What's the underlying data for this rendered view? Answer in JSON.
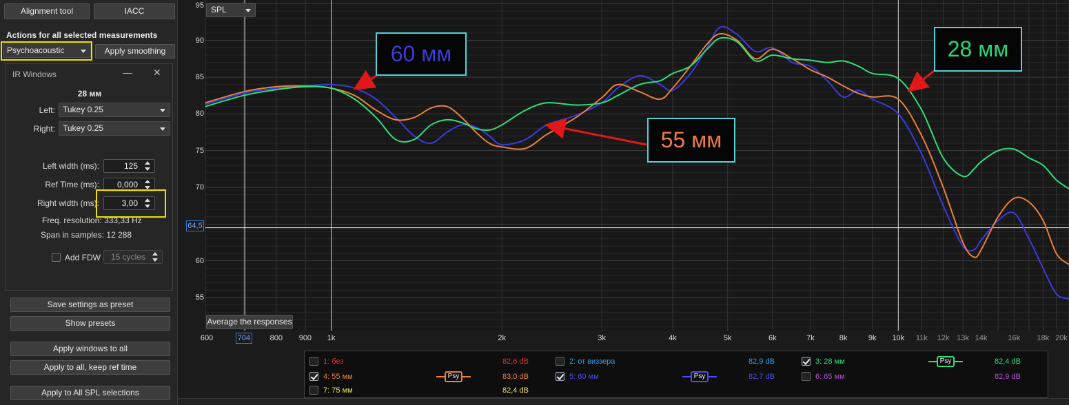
{
  "left_panel": {
    "alignment_tool": "Alignment tool",
    "iacc": "IACC",
    "actions_label": "Actions for all selected measurements",
    "smoothing_select": "Psychoacoustic",
    "apply_smoothing": "Apply smoothing",
    "save_preset": "Save settings as preset",
    "show_presets": "Show presets",
    "apply_windows_all": "Apply windows to all",
    "apply_keep_ref": "Apply to all, keep ref time",
    "apply_all_spl": "Apply to All SPL selections"
  },
  "ir_windows": {
    "title": "IR Windows",
    "minimize": "—",
    "close": "✕",
    "measurement_name": "28 мм",
    "left_label": "Left:",
    "left_value": "Tukey 0.25",
    "right_label": "Right:",
    "right_value": "Tukey 0.25",
    "left_width_label": "Left width (ms):",
    "left_width_value": "125",
    "ref_time_label": "Ref Time (ms):",
    "ref_time_value": "0,000",
    "right_width_label": "Right width (ms):",
    "right_width_value": "3,00",
    "freq_res_label": "Freq. resolution:",
    "freq_res_value": "333,33 Hz",
    "span_label": "Span in samples:",
    "span_value": "12 288",
    "add_fdw_label": "Add FDW",
    "fdw_cycles": "15 cycles"
  },
  "chart_controls": {
    "spl_select": "SPL",
    "average_button": "Average the responses",
    "cursor_y": "64,5",
    "cursor_x": "704"
  },
  "annotations": [
    {
      "text": "60 мм",
      "color": "#3b3bd6"
    },
    {
      "text": "55 мм",
      "color": "#f07848"
    },
    {
      "text": "28 мм",
      "color": "#27d67a"
    }
  ],
  "chart_data": {
    "type": "line",
    "xscale": "log",
    "xlim": [
      600,
      20000
    ],
    "ylim": [
      50.5,
      95.5
    ],
    "x_ticks": [
      "600",
      "800",
      "900",
      "1k",
      "2k",
      "3k",
      "4k",
      "5k",
      "6k",
      "7k",
      "8k",
      "9k",
      "10k",
      "11k",
      "12k",
      "13k",
      "14k",
      "16k",
      "18k",
      "20k"
    ],
    "y_ticks": [
      95,
      90,
      85,
      80,
      75,
      70,
      65,
      60,
      55
    ],
    "y_ticks_shown": [
      "95",
      "90",
      "85",
      "80",
      "75",
      "70",
      "60",
      "55"
    ],
    "series": [
      {
        "name": "5: 60 мм",
        "color": "#3a3ae0",
        "x": [
          600,
          700,
          800,
          900,
          1000,
          1100,
          1200,
          1300,
          1400,
          1500,
          1600,
          1700,
          1800,
          1900,
          2000,
          2200,
          2400,
          2700,
          3000,
          3200,
          3500,
          3800,
          4000,
          4300,
          4600,
          4850,
          5200,
          5600,
          6000,
          6500,
          7000,
          7500,
          8000,
          8500,
          9000,
          10000,
          11000,
          12000,
          13000,
          13600,
          14000,
          15000,
          16000,
          17000,
          18000,
          19000,
          20000
        ],
        "y": [
          81.3,
          82.8,
          83.5,
          83.8,
          84.0,
          83.5,
          82.0,
          79.5,
          77.0,
          76.0,
          77.5,
          78.5,
          78.2,
          77.0,
          75.8,
          76.5,
          78.5,
          79.8,
          81.5,
          83.5,
          85.2,
          84.0,
          83.2,
          85.5,
          89.0,
          91.8,
          90.8,
          88.5,
          89.0,
          87.0,
          86.5,
          84.5,
          82.3,
          83.2,
          82.0,
          80.0,
          74.5,
          67.5,
          62.0,
          61.5,
          62.8,
          65.5,
          66.5,
          63.0,
          59.0,
          55.5,
          54.8
        ]
      },
      {
        "name": "4: 55 мм",
        "color": "#e8823a",
        "x": [
          600,
          700,
          800,
          900,
          1000,
          1100,
          1200,
          1300,
          1400,
          1500,
          1600,
          1700,
          1800,
          1900,
          2000,
          2200,
          2400,
          2700,
          3000,
          3200,
          3500,
          3800,
          4000,
          4300,
          4600,
          4850,
          5200,
          5600,
          6000,
          6500,
          7000,
          7500,
          8000,
          8500,
          9000,
          10000,
          11000,
          12000,
          13000,
          13600,
          14000,
          15000,
          16000,
          17000,
          18000,
          19000,
          20000
        ],
        "y": [
          81.5,
          83.0,
          83.7,
          83.8,
          83.5,
          82.5,
          80.5,
          79.2,
          79.5,
          80.8,
          81.0,
          79.5,
          77.5,
          76.0,
          75.5,
          75.3,
          77.2,
          79.5,
          82.2,
          84.0,
          83.0,
          82.0,
          83.5,
          86.5,
          89.5,
          90.9,
          90.0,
          87.5,
          88.8,
          87.5,
          86.0,
          85.0,
          83.8,
          82.8,
          82.3,
          82.0,
          77.0,
          70.0,
          62.5,
          60.5,
          61.5,
          66.0,
          68.5,
          68.0,
          65.5,
          61.0,
          59.5
        ]
      },
      {
        "name": "3: 28 мм",
        "color": "#2ee07a",
        "x": [
          600,
          700,
          800,
          900,
          1000,
          1100,
          1200,
          1300,
          1400,
          1500,
          1600,
          1700,
          1800,
          1900,
          2000,
          2200,
          2400,
          2700,
          3000,
          3200,
          3500,
          3800,
          4000,
          4300,
          4600,
          4850,
          5200,
          5600,
          6000,
          6500,
          7000,
          7500,
          8000,
          8500,
          9000,
          10000,
          11000,
          12000,
          13000,
          13600,
          14000,
          15000,
          16000,
          17000,
          18000,
          19000,
          20000
        ],
        "y": [
          81.0,
          82.5,
          83.3,
          83.7,
          83.5,
          82.0,
          79.5,
          76.5,
          76.5,
          78.5,
          79.2,
          78.8,
          78.0,
          77.8,
          78.5,
          80.5,
          81.5,
          81.2,
          81.5,
          82.5,
          84.0,
          84.5,
          85.5,
          86.5,
          88.8,
          90.3,
          89.8,
          87.2,
          88.0,
          87.5,
          87.3,
          87.0,
          87.2,
          86.5,
          85.5,
          84.8,
          80.5,
          74.0,
          71.5,
          72.5,
          73.5,
          75.0,
          75.2,
          74.0,
          73.0,
          71.0,
          69.8
        ]
      }
    ],
    "hidden_series": [
      "1: без",
      "2: от виззера",
      "6: 65 мм",
      "7: 75 мм"
    ]
  },
  "legend": {
    "items": [
      {
        "label": "1: без",
        "value": "82,6 dB",
        "color": "#d23b3b",
        "checked": false,
        "psy": false
      },
      {
        "label": "2: от виззера",
        "value": "82,9 dB",
        "color": "#3aa0e0",
        "checked": false,
        "psy": false
      },
      {
        "label": "3: 28 мм",
        "value": "82,4 dB",
        "color": "#2ee07a",
        "checked": true,
        "psy": true
      },
      {
        "label": "4: 55 мм",
        "value": "83,0 dB",
        "color": "#e8823a",
        "checked": true,
        "psy": true
      },
      {
        "label": "5: 60 мм",
        "value": "82,7 dB",
        "color": "#4b4bf0",
        "checked": true,
        "psy": true
      },
      {
        "label": "6: 65 мм",
        "value": "82,9 dB",
        "color": "#b050d0",
        "checked": false,
        "psy": false
      },
      {
        "label": "7: 75 мм",
        "value": "82,4 dB",
        "color": "#e8e060",
        "checked": false,
        "psy": false
      }
    ],
    "psy_label": "Psy"
  }
}
